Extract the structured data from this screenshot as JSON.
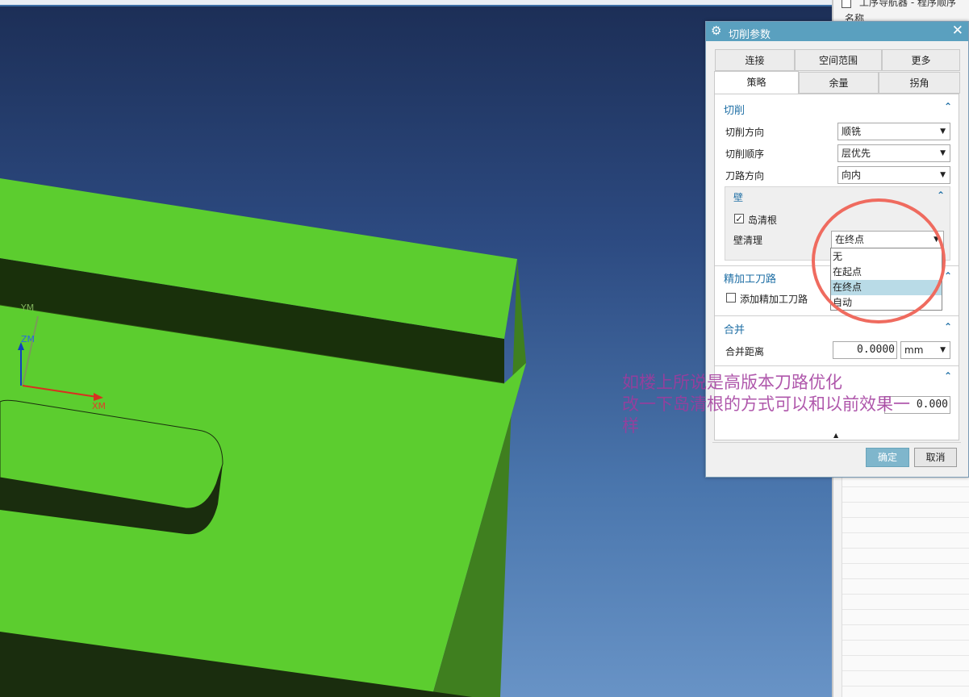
{
  "viewport": {
    "axes": {
      "ym": "YM",
      "zm": "ZM",
      "xm": "XM"
    }
  },
  "right_panel": {
    "top_text": "工序导航器 - 程序顺序",
    "header": "名称"
  },
  "dialog": {
    "title": "切削参数",
    "tabs_row1": [
      "连接",
      "空间范围",
      "更多"
    ],
    "tabs_row2": [
      "策略",
      "余量",
      "拐角"
    ],
    "active_tab": "策略",
    "cut_section": {
      "title": "切削",
      "cut_direction_label": "切削方向",
      "cut_direction_value": "顺铣",
      "cut_order_label": "切削顺序",
      "cut_order_value": "层优先",
      "pattern_direction_label": "刀路方向",
      "pattern_direction_value": "向内"
    },
    "wall_section": {
      "title": "壁",
      "island_cleanup_label": "岛清根",
      "island_cleanup_checked": true,
      "wall_cleanup_label": "壁清理",
      "wall_cleanup_value": "在终点",
      "wall_cleanup_options": [
        "无",
        "在起点",
        "在终点",
        "自动"
      ],
      "highlighted_option": "在终点"
    },
    "finish_section": {
      "title": "精加工刀路",
      "add_finish_label": "添加精加工刀路",
      "add_finish_checked": false
    },
    "merge_section": {
      "title": "合并",
      "merge_distance_label": "合并距离",
      "merge_distance_value": "0.0000",
      "merge_distance_unit": "mm"
    },
    "partial_row": {
      "value": "0.000"
    },
    "ok_label": "确定",
    "cancel_label": "取消"
  },
  "annotation": {
    "line1": "如楼上所说是高版本刀路优化",
    "line2": "改一下岛清根的方式可以和以前效果一",
    "line3": "样"
  },
  "colors": {
    "annotation_text": "#a23a9d",
    "highlight_circle": "#ef6b5f",
    "dialog_title_bar": "#5aa0bf",
    "part_top_face": "#5ccd2f",
    "part_dark_face": "#1a2d0e"
  }
}
